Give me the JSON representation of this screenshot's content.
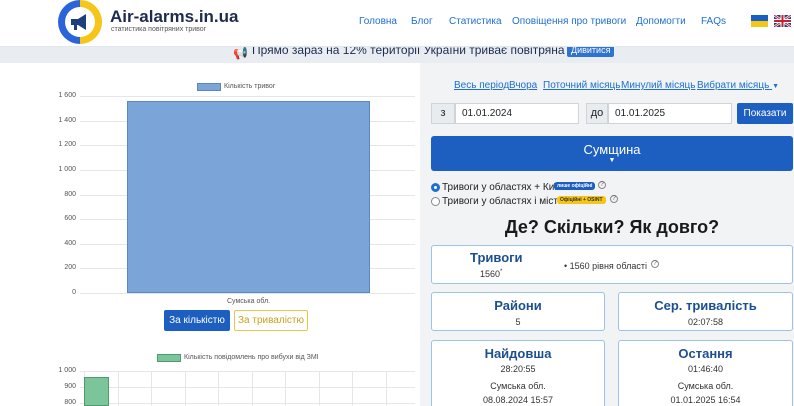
{
  "header": {
    "brand": "Air-alarms.in.ua",
    "tagline": "статистика повітряних тривог",
    "nav": [
      "Головна",
      "Блог",
      "Статистика",
      "Оповіщення про тривоги",
      "Допомогти",
      "FAQs"
    ],
    "languages": [
      "ua",
      "en"
    ]
  },
  "banner": {
    "text": "Прямо зараз на 12% території України триває повітряна тривога",
    "button": "Дивитися"
  },
  "left": {
    "chart1_button_count": "За кількістю",
    "chart1_button_duration": "За тривалістю"
  },
  "chart_data": [
    {
      "type": "bar",
      "categories": [
        "Сумська обл."
      ],
      "series": [
        {
          "name": "Кількість тривог",
          "values": [
            1560
          ]
        }
      ],
      "yticks": [
        "1 600",
        "1 400",
        "1 200",
        "1 000",
        "800",
        "600",
        "400",
        "200",
        "0"
      ],
      "ylim": [
        0,
        1600
      ],
      "grid": true,
      "legend": "top"
    },
    {
      "type": "bar",
      "series": [
        {
          "name": "Кількість повідомлень про вибухи від ЗМІ",
          "values": [
            960
          ]
        }
      ],
      "yticks": [
        "1 000",
        "900",
        "800"
      ],
      "grid": true,
      "legend": "top"
    }
  ],
  "period": {
    "links": [
      "Весь період",
      "Вчора",
      "Поточний місяць",
      "Минулий місяць",
      "Вибрати місяць"
    ],
    "from_label": "з",
    "from_value": "01.01.2024",
    "to_label": "до",
    "to_value": "01.01.2025",
    "show_button": "Показати"
  },
  "region": {
    "selected": "Сумщина",
    "caret": "▼"
  },
  "options": {
    "opt1": "Тривоги у областях + Київ",
    "opt1_badge": "лише офіційні",
    "opt2": "Тривоги у областях і містах",
    "opt2_badge": "Офіційні + OSINT"
  },
  "question": "Де? Скільки? Як довго?",
  "stats": {
    "alarms_title": "Тривоги",
    "alarms_value": "1560",
    "alarms_level": "1560 рівня області",
    "districts_title": "Райони",
    "districts_value": "5",
    "avg_title": "Сер. тривалість",
    "avg_value": "02:07:58",
    "longest_title": "Найдовша",
    "longest_value": "28:20:55",
    "longest_region": "Сумська обл.",
    "longest_date": "08.08.2024 15:57",
    "last_title": "Остання",
    "last_value": "01:46:40",
    "last_region": "Сумська обл.",
    "last_date": "01.01.2025 16:54"
  },
  "colors": {
    "primary": "#1d5fc0",
    "bar_blue": "#7ba4d9",
    "bar_green": "#7cc59a"
  }
}
